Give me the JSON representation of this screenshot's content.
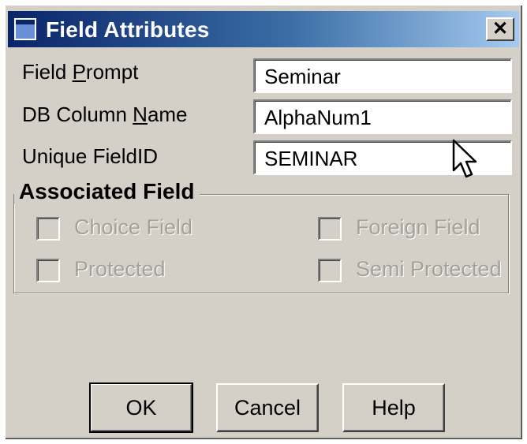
{
  "window": {
    "title": "Field Attributes",
    "close_glyph": "✕"
  },
  "fields": [
    {
      "label_pre": "Field ",
      "label_key": "P",
      "label_post": "rompt",
      "value": "Seminar"
    },
    {
      "label_pre": "DB Column ",
      "label_key": "N",
      "label_post": "ame",
      "value": "AlphaNum1"
    },
    {
      "label_pre": "Unique FieldID",
      "label_key": "",
      "label_post": "",
      "value": "SEMINAR"
    }
  ],
  "group": {
    "title": "Associated Field",
    "checkboxes": [
      {
        "label": "Choice Field",
        "checked": false,
        "enabled": false
      },
      {
        "label": "Foreign Field",
        "checked": false,
        "enabled": false
      },
      {
        "label": "Protected",
        "checked": false,
        "enabled": false
      },
      {
        "label": "Semi Protected",
        "checked": false,
        "enabled": false
      }
    ]
  },
  "buttons": {
    "ok": "OK",
    "cancel": "Cancel",
    "help": "Help"
  },
  "icons": {
    "window": "window-icon",
    "close": "close-icon",
    "cursor": "mouse-pointer-icon"
  }
}
